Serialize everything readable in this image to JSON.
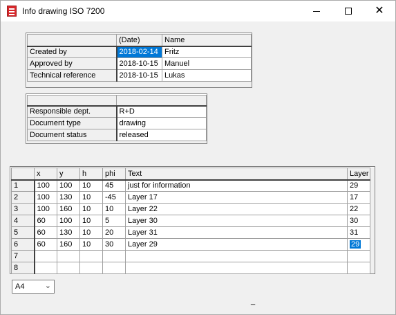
{
  "window": {
    "title": "Info drawing ISO 7200"
  },
  "people_table": {
    "headers": [
      "",
      "(Date)",
      "Name"
    ],
    "rows": [
      {
        "label": "Created by",
        "date": "2018-02-14",
        "name": "Fritz"
      },
      {
        "label": "Approved by",
        "date": "2018-10-15",
        "name": "Manuel"
      },
      {
        "label": "Technical reference",
        "date": "2018-10-15",
        "name": "Lukas"
      }
    ]
  },
  "doc_table": {
    "headers": [
      "",
      ""
    ],
    "rows": [
      {
        "label": "Responsible dept.",
        "value": "R+D"
      },
      {
        "label": "Document type",
        "value": "drawing"
      },
      {
        "label": "Document status",
        "value": "released"
      }
    ]
  },
  "text_table": {
    "headers": [
      "",
      "x",
      "y",
      "h",
      "phi",
      "Text",
      "Layer"
    ],
    "rows": [
      {
        "n": "1",
        "x": "100",
        "y": "100",
        "h": "10",
        "phi": "45",
        "text": "just for information",
        "layer": "29"
      },
      {
        "n": "2",
        "x": "100",
        "y": "130",
        "h": "10",
        "phi": "-45",
        "text": "Layer 17",
        "layer": "17"
      },
      {
        "n": "3",
        "x": "100",
        "y": "160",
        "h": "10",
        "phi": "10",
        "text": "Layer 22",
        "layer": "22"
      },
      {
        "n": "4",
        "x": "60",
        "y": "100",
        "h": "10",
        "phi": "5",
        "text": "Layer 30",
        "layer": "30"
      },
      {
        "n": "5",
        "x": "60",
        "y": "130",
        "h": "10",
        "phi": "20",
        "text": "Layer 31",
        "layer": "31"
      },
      {
        "n": "6",
        "x": "60",
        "y": "160",
        "h": "10",
        "phi": "30",
        "text": "Layer  29",
        "layer": "29"
      },
      {
        "n": "7",
        "x": "",
        "y": "",
        "h": "",
        "phi": "",
        "text": "",
        "layer": ""
      },
      {
        "n": "8",
        "x": "",
        "y": "",
        "h": "",
        "phi": "",
        "text": "",
        "layer": ""
      }
    ]
  },
  "paper_size": {
    "selected": "A4"
  },
  "status": {
    "mark": "_"
  },
  "colors": {
    "selection": "#0078d7"
  }
}
